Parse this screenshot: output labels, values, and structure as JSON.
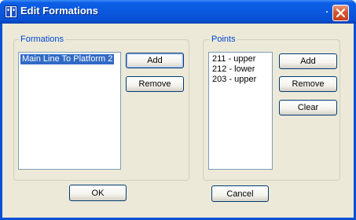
{
  "window": {
    "title": "Edit Formations",
    "icon": "app-icon",
    "close_icon": "close-icon"
  },
  "formations": {
    "label": "Formations",
    "items": [
      "Main Line To Platform 2"
    ],
    "selected_index": 0,
    "add_label": "Add",
    "remove_label": "Remove"
  },
  "points": {
    "label": "Points",
    "items": [
      "211 - upper",
      "212 - lower",
      "203 - upper"
    ],
    "add_label": "Add",
    "remove_label": "Remove",
    "clear_label": "Clear"
  },
  "footer": {
    "ok_label": "OK",
    "cancel_label": "Cancel"
  },
  "colors": {
    "titlebar": "#0a58df",
    "dialog_bg": "#ece9d8",
    "group_label": "#0046d5",
    "selection": "#316ac5",
    "close_button": "#d4562f"
  }
}
